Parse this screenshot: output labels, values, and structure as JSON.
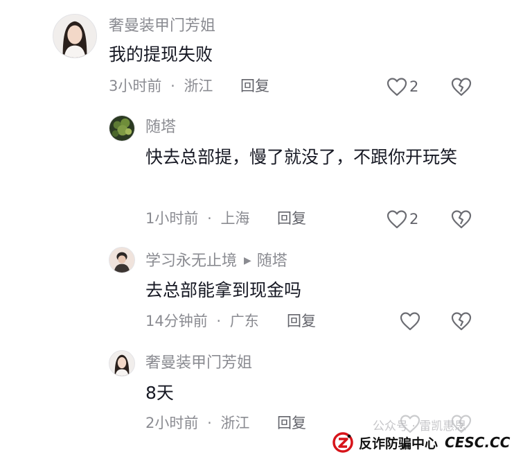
{
  "comments": [
    {
      "username": "奢曼装甲门芳姐",
      "text": "我的提现失败",
      "time": "3小时前",
      "location": "浙江",
      "reply_label": "回复",
      "like_count": "2"
    },
    {
      "username": "随塔",
      "text": "快去总部提，慢了就没了，不跟你开玩笑",
      "time": "1小时前",
      "location": "上海",
      "reply_label": "回复",
      "like_count": "2"
    },
    {
      "username": "学习永无止境",
      "reply_to": "随塔",
      "text": "去总部能拿到现金吗",
      "time": "14分钟前",
      "location": "广东",
      "reply_label": "回复",
      "like_count": ""
    },
    {
      "username": "奢曼装甲门芳姐",
      "text": "8天",
      "time": "2小时前",
      "location": "浙江",
      "reply_label": "回复",
      "like_count": ""
    }
  ],
  "meta_separator": "·",
  "icons": {
    "like": "heart-outline-icon",
    "dislike": "broken-heart-icon",
    "reply_arrow": "triangle-right-icon"
  },
  "colors": {
    "primary_text": "#161823",
    "secondary_text": "#8a8b91",
    "brand_red": "#d7141a"
  },
  "watermark": {
    "faint_text": "公众号 · 雷凯惠思",
    "brand_name": "反诈防骗中心",
    "brand_domain": "CESC.CC"
  }
}
